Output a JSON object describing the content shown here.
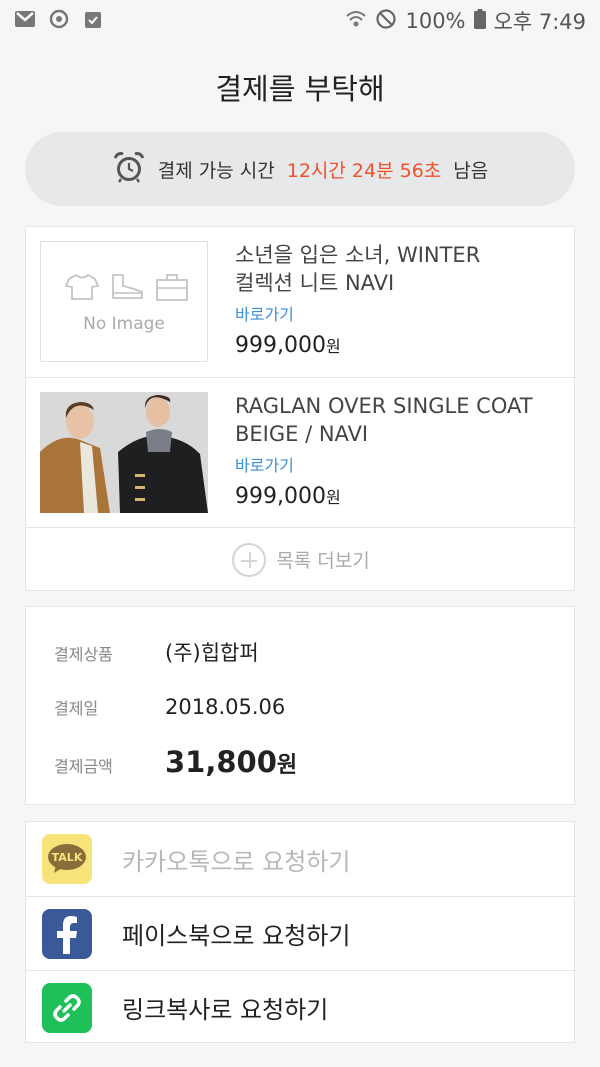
{
  "status_bar": {
    "battery": "100%",
    "time": "오후 7:49"
  },
  "title": "결제를 부탁해",
  "timer": {
    "prefix": "결제 가능 시간",
    "remaining": "12시간 24분 56초",
    "suffix": "남음"
  },
  "products": [
    {
      "name_line1": "소년을 입은 소녀, WINTER",
      "name_line2": "컬렉션 니트 NAVI",
      "link_label": "바로가기",
      "price": "999,000",
      "currency": "원",
      "image_placeholder": "No Image"
    },
    {
      "name_line1": "RAGLAN OVER SINGLE COAT",
      "name_line2": "BEIGE / NAVI",
      "link_label": "바로가기",
      "price": "999,000",
      "currency": "원"
    }
  ],
  "more_label": "목록 더보기",
  "summary": {
    "product_label": "결제상품",
    "product_value": "(주)힙합퍼",
    "date_label": "결제일",
    "date_value": "2018.05.06",
    "amount_label": "결제금액",
    "amount_value": "31,800",
    "amount_currency": "원"
  },
  "share": {
    "kakao_label": "카카오톡으로 요청하기",
    "kakao_icon_text": "TALK",
    "facebook_label": "페이스북으로 요청하기",
    "link_label": "링크복사로 요청하기"
  },
  "colors": {
    "accent_orange": "#f0532a",
    "link_blue": "#3b8fd6",
    "kakao_yellow": "#f7e37a",
    "facebook_blue": "#3b5998",
    "link_green": "#1fc05a"
  }
}
